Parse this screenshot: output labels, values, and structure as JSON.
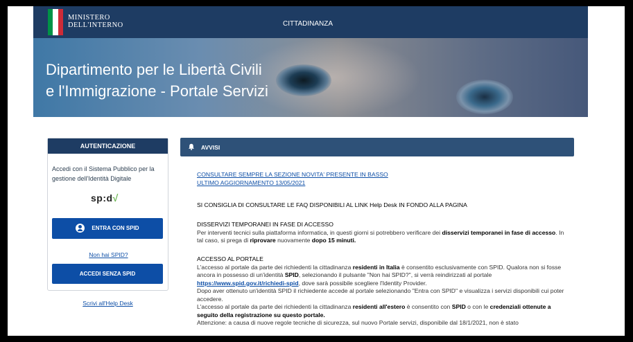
{
  "header": {
    "ministry_line1": "MINISTERO",
    "ministry_line2": "DELL'INTERNO",
    "nav_label": "CITTADINANZA",
    "flag_colors": [
      "#009246",
      "#ffffff",
      "#ce2b37"
    ]
  },
  "hero": {
    "title_line1": "Dipartimento per le Libertà Civili",
    "title_line2": "e l'Immigrazione - Portale Servizi"
  },
  "sidebar": {
    "title": "AUTENTICAZIONE",
    "description": "Accedi con il Sistema Pubblico per la gestione dell'Identità Digitale",
    "spid_logo_text": "sp:d",
    "spid_logo_check": "√",
    "login_spid_label": "ENTRA CON SPID",
    "no_spid_link": "Non hai SPID?",
    "login_no_spid_label": "ACCEDI SENZA SPID",
    "helpdesk_link": "Scrivi all'Help Desk"
  },
  "notices": {
    "title": "AVVISI",
    "line_novita": "CONSULTARE SEMPRE LA SEZIONE NOVITA' PRESENTE IN BASSO",
    "line_update": "ULTIMO AGGIORNAMENTO 13/05/2021",
    "faq": "SI CONSIGLIA DI CONSULTARE LE FAQ DISPONIBILI AL LINK Help Desk IN FONDO ALLA PAGINA",
    "disservizi_title": "DISSERVIZI TEMPORANEI IN FASE DI ACCESSO",
    "disservizi_a": "Per interventi tecnici sulla piattaforma informatica, in questi giorni si potrebbero verificare dei ",
    "disservizi_b": "disservizi temporanei in fase di accesso",
    "disservizi_c": ". In tal caso, si prega di ",
    "disservizi_d": "riprovare",
    "disservizi_e": " nuovamente ",
    "disservizi_f": "dopo 15 minuti.",
    "accesso_title": "ACCESSO AL PORTALE",
    "accesso1_a": "L'accesso al portale da parte dei richiedenti la cittadinanza ",
    "accesso1_b": "residenti in Italia",
    "accesso1_c": " è consentito esclusivamente con SPID. Qualora non si fosse ancora in possesso di un'identità ",
    "accesso1_d": "SPID",
    "accesso1_e": ", selezionando il pulsante \"Non hai SPID?\", si verrà reindirizzati al portale ",
    "accesso1_link": "https://www.spid.gov.it/richiedi-spid",
    "accesso1_f": ", dove sarà possibile scegliere l'Identity Provider.",
    "accesso2": "Dopo aver ottenuto un'identità SPID il richiedente accede al portale selezionando \"Entra con SPID\" e visualizza i servizi disponibili cui poter accedere.",
    "accesso3_a": "L'accesso al portale da parte dei richiedenti la cittadinanza ",
    "accesso3_b": "residenti all'estero",
    "accesso3_c": " è consentito con ",
    "accesso3_d": "SPID",
    "accesso3_e": " o con le ",
    "accesso3_f": "credenziali ottenute a seguito della registrazione su questo portale.",
    "attenzione": "Attenzione: a causa di nuove regole tecniche di sicurezza, sul nuovo Portale servizi, disponibile dal 18/1/2021, non è stato"
  }
}
